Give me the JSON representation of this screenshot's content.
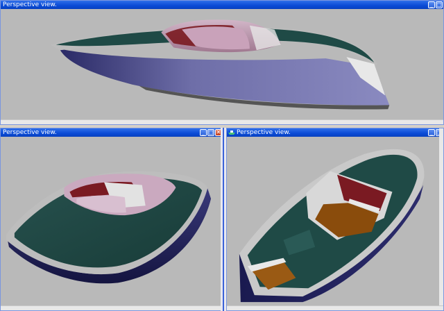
{
  "windows": [
    {
      "title": "Perspective view.",
      "controls": [
        "minimize",
        "maximize"
      ]
    },
    {
      "title": "Perspective view.",
      "controls": [
        "minimize",
        "maximize",
        "close"
      ]
    },
    {
      "title": "Perspective view.",
      "controls": [
        "minimize",
        "maximize"
      ]
    }
  ],
  "icons": {
    "minimize": "minimize-icon",
    "maximize": "maximize-icon",
    "close": "close-icon",
    "app": "boat-app-icon"
  },
  "colors": {
    "title_bar": "#0a4bd6",
    "viewport_bg": "#b9b9b9",
    "deck": "#1f4a46",
    "hull": "#6e6ea4",
    "hull_dark": "#22225a",
    "cockpit": "#b48ca4",
    "trim": "#c8c8c8",
    "interior": "#8a4c0c"
  }
}
